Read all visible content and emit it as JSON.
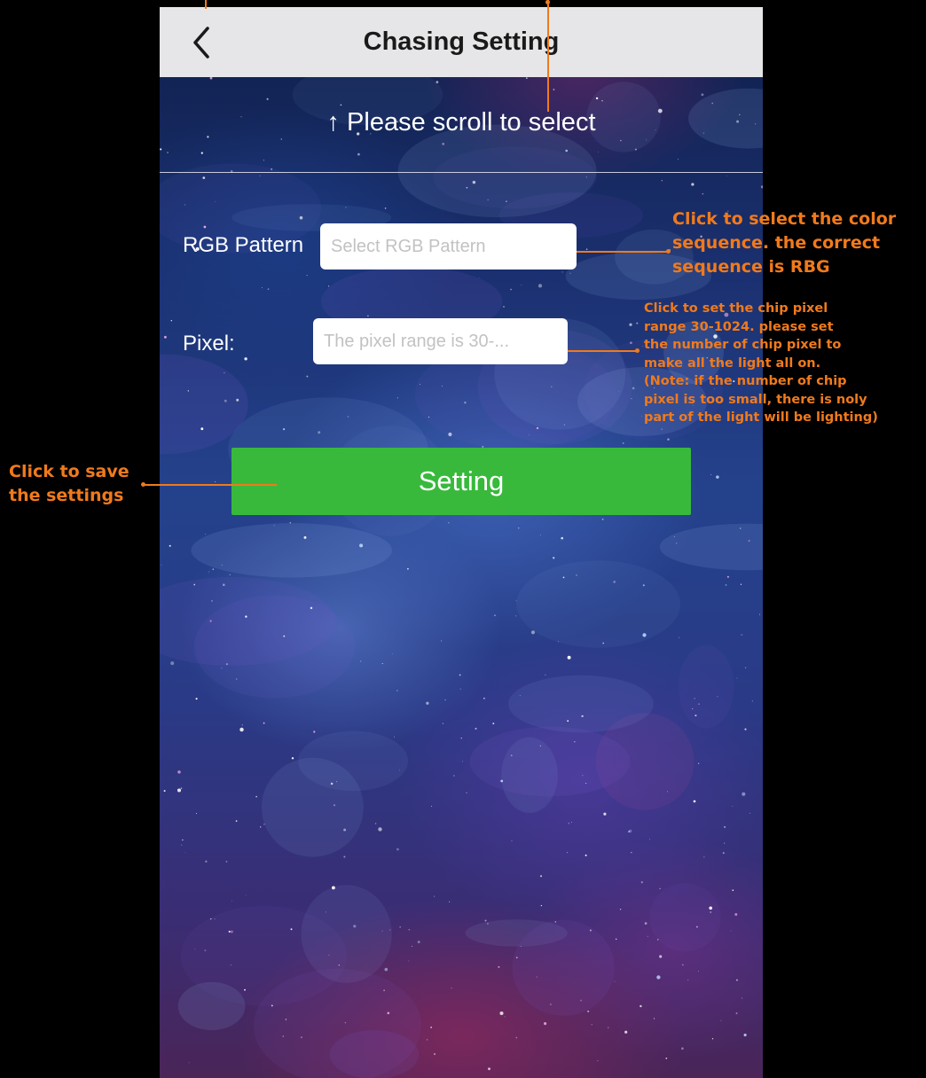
{
  "navbar": {
    "title": "Chasing Setting",
    "back_icon": "chevron-left-icon"
  },
  "scroll_hint": "↑ Please scroll to select",
  "form": {
    "rgb_pattern": {
      "label": "RGB Pattern",
      "placeholder": "Select RGB Pattern"
    },
    "pixel": {
      "label": "Pixel:",
      "placeholder": "The pixel range is 30-..."
    },
    "setting_button": "Setting"
  },
  "annotations": {
    "color_sequence": [
      "Click to select the color",
      "sequence. the correct",
      "sequence is RBG"
    ],
    "pixel_range": [
      "Click to set the chip pixel",
      "range 30-1024. please set",
      "the number of chip pixel to",
      "make all the light all on.",
      "(Note: if the number of chip",
      "pixel is too small, there is noly",
      "part of the light will be lighting)"
    ],
    "save": [
      "Click to save",
      "the settings"
    ]
  },
  "colors": {
    "navbar_bg": "#e6e6e8",
    "button_green": "#38b93c",
    "annotation_orange": "#f07a1c"
  }
}
